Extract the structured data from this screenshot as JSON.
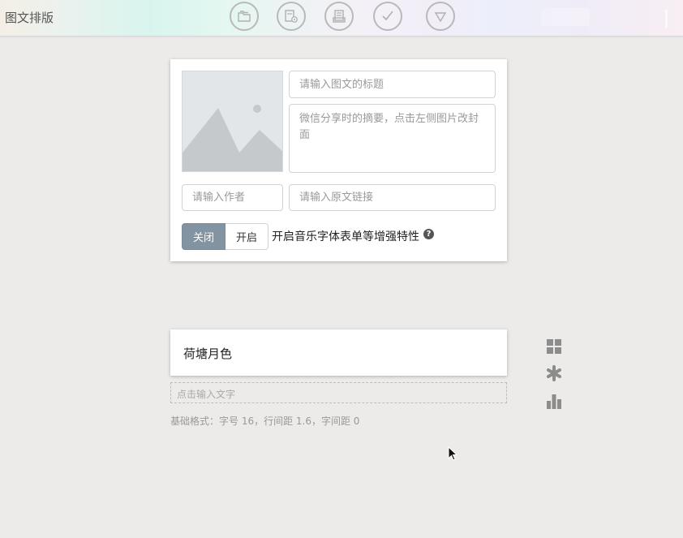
{
  "app": {
    "title": "图文排版"
  },
  "toolbar": {
    "buttons": [
      {
        "name": "folder-icon"
      },
      {
        "name": "preview-icon"
      },
      {
        "name": "document-icon"
      },
      {
        "name": "checkmark-icon"
      },
      {
        "name": "triangle-down-icon"
      }
    ]
  },
  "editor": {
    "title_placeholder": "请输入图文的标题",
    "summary_placeholder": "微信分享时的摘要，点击左侧图片改封面",
    "author_placeholder": "请输入作者",
    "source_link_placeholder": "请输入原文链接",
    "toggle_off_label": "关闭",
    "toggle_on_label": "开启",
    "toggle_selected": "关闭",
    "feature_label": "开启音乐字体表单等增强特性",
    "help_glyph": "?"
  },
  "article": {
    "title": "荷塘月色",
    "text_input_placeholder": "点击输入文字",
    "format_info": "基础格式：字号 16，行间距 1.6，字间距 0"
  },
  "side_tools": [
    {
      "name": "grid-icon"
    },
    {
      "name": "asterisk-icon"
    },
    {
      "name": "bar-chart-icon"
    }
  ],
  "colors": {
    "toggle_active": "#8293a2",
    "background": "#ecebe9",
    "icon_gray": "#8c8c8c"
  }
}
